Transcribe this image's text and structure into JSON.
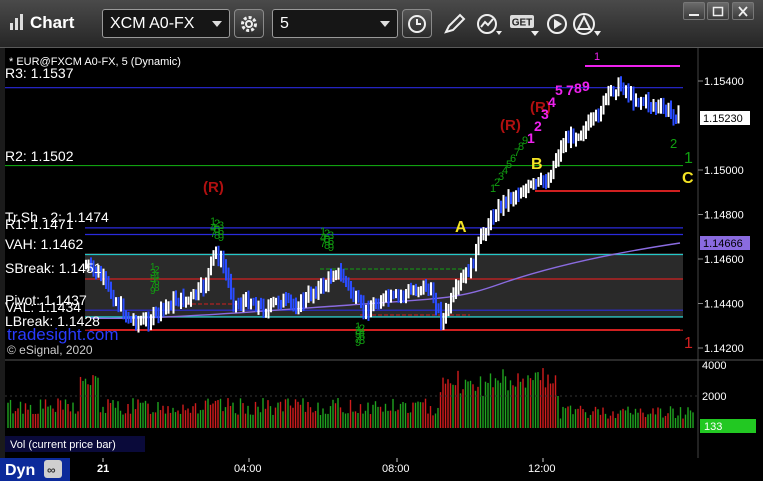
{
  "window": {
    "title": "Chart",
    "symbol": "XCM A0-FX",
    "interval": "5",
    "toolbar_icons": [
      "gear-icon",
      "clock-icon",
      "pen-icon",
      "study-icon",
      "get-icon",
      "play-icon",
      "alert-icon"
    ],
    "get_label": "GET",
    "window_buttons": [
      "minimize-icon",
      "maximize-icon",
      "close-icon"
    ]
  },
  "chart": {
    "header": "* EUR@FXCM A0-FX, 5 (Dynamic)",
    "copyright": "© eSignal, 2020",
    "watermark": "tradesight.com",
    "levels": [
      {
        "label": "R3: 1.1537",
        "value": 1.1537,
        "color": "#2a2adc"
      },
      {
        "label": "R2: 1.1502",
        "value": 1.1502,
        "color": "#10a010"
      },
      {
        "label": "Tr.Sh - 2: 1.1474",
        "value": 1.1474,
        "color": "#2a2adc"
      },
      {
        "label": "R1: 1.1471",
        "value": 1.1471,
        "color": "#2a2adc"
      },
      {
        "label": "VAH: 1.1462",
        "value": 1.1462,
        "color": "#22c8c8"
      },
      {
        "label": "SBreak: 1.1451",
        "value": 1.1451,
        "color": "#d02020"
      },
      {
        "label": "Pivot: 1.1437",
        "value": 1.1437,
        "color": "#2a2adc"
      },
      {
        "label": "VAL: 1.1434",
        "value": 1.1434,
        "color": "#22c8c8"
      },
      {
        "label": "LBreak: 1.1428",
        "value": 1.1428,
        "color": "#d02020"
      }
    ],
    "price_ticks": [
      "1.15400",
      "1.15000",
      "1.14800",
      "1.14600",
      "1.14400",
      "1.14200"
    ],
    "last_price": "1.15230",
    "ma_price": "1.14666",
    "time_ticks": [
      "21",
      "04:00",
      "08:00",
      "12:00"
    ],
    "annotations": {
      "a": "A",
      "b": "B",
      "c": "C",
      "r_signal": "(R)",
      "target_1": "1",
      "target_2": "2",
      "seq_red": "12345",
      "seq_mag": "789",
      "seq_green": "123456789"
    },
    "volume": {
      "label": "Vol (current price bar)",
      "ticks": [
        "4000",
        "2000"
      ],
      "last_value": "133"
    },
    "bottom": {
      "label": "Dyn"
    }
  },
  "colors": {
    "up_bar": "#ffffff",
    "down_bar": "#2a4cff",
    "vol_up": "#1fa41f",
    "vol_down": "#d01c1c",
    "ma_line": "#8a6be0",
    "sequential_green": "#11a011",
    "sequential_magenta": "#ee22ee",
    "signal_red": "#b01010",
    "abc_yellow": "#f4e424"
  }
}
